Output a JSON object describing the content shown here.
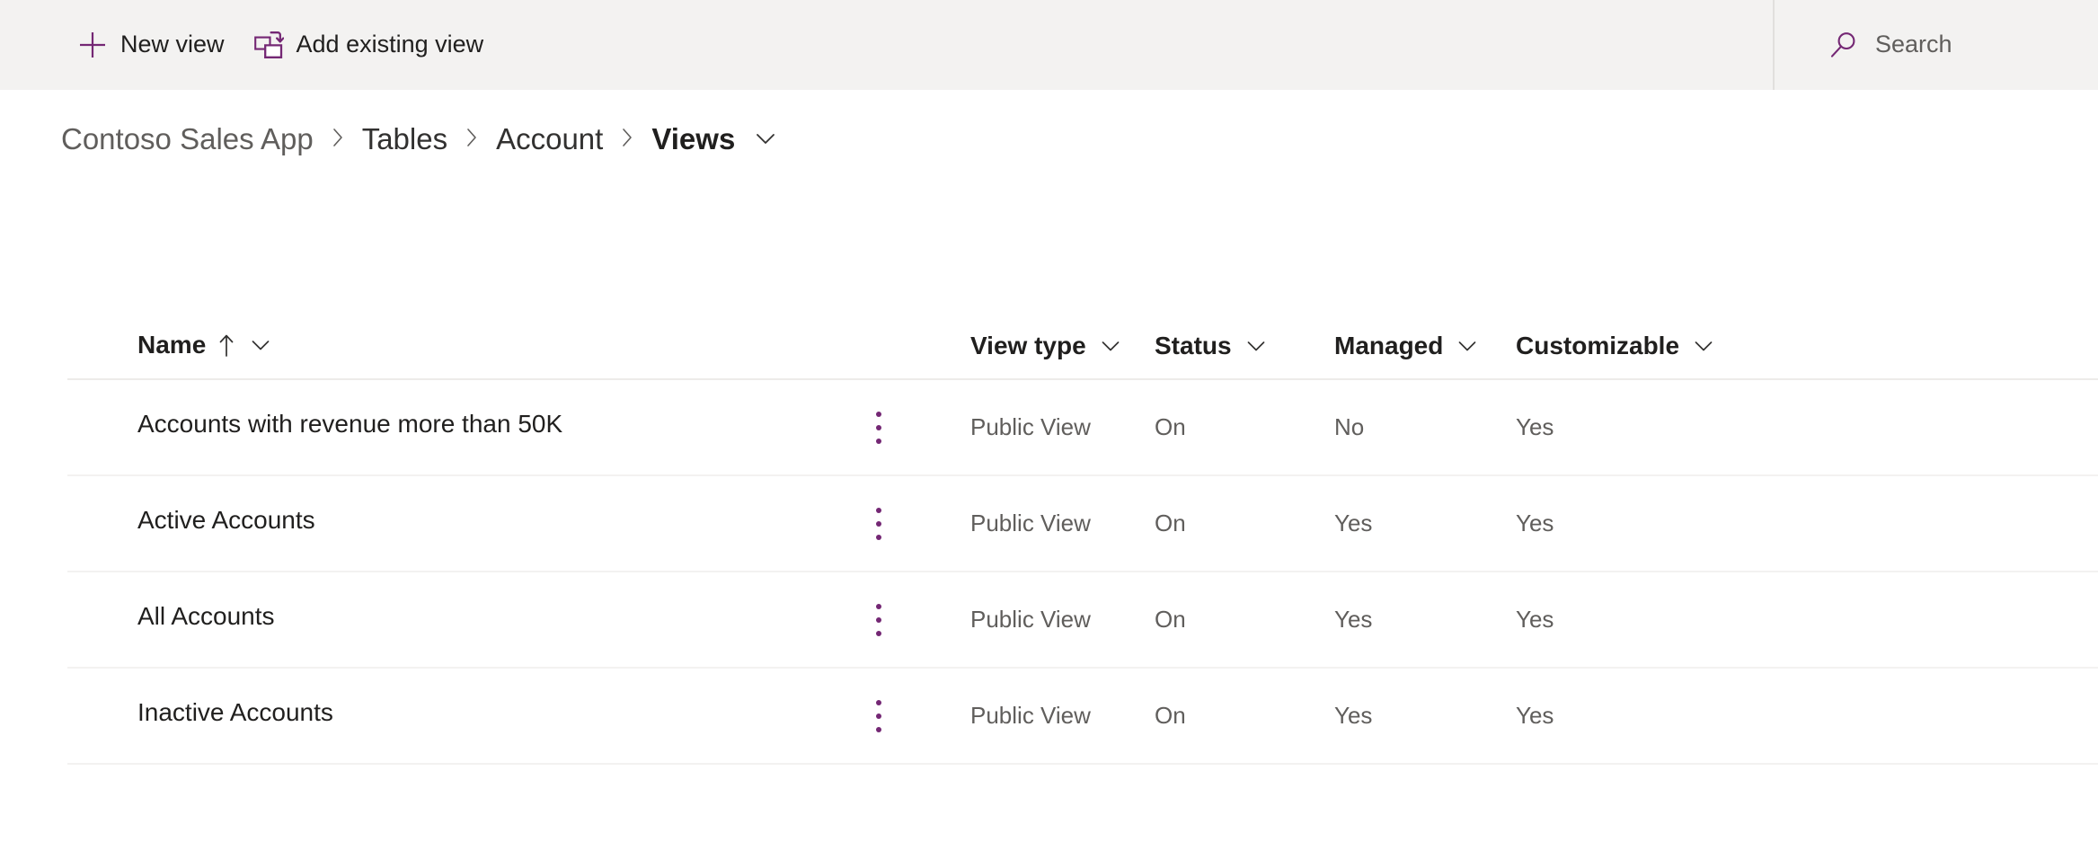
{
  "commandbar": {
    "new_view_label": "New view",
    "add_existing_label": "Add existing view",
    "search_label": "Search",
    "accent_color": "#742774",
    "background": "#f3f2f1"
  },
  "breadcrumb": {
    "items": [
      {
        "label": "Contoso Sales App",
        "current": false
      },
      {
        "label": "Tables",
        "current": false
      },
      {
        "label": "Account",
        "current": false
      },
      {
        "label": "Views",
        "current": true
      }
    ],
    "separator": "›"
  },
  "grid": {
    "columns": [
      {
        "key": "name",
        "label": "Name",
        "sorted": "asc"
      },
      {
        "key": "view_type",
        "label": "View type"
      },
      {
        "key": "status",
        "label": "Status"
      },
      {
        "key": "managed",
        "label": "Managed"
      },
      {
        "key": "customizable",
        "label": "Customizable"
      }
    ],
    "rows": [
      {
        "name": "Accounts with revenue more than 50K",
        "view_type": "Public View",
        "status": "On",
        "managed": "No",
        "customizable": "Yes"
      },
      {
        "name": "Active Accounts",
        "view_type": "Public View",
        "status": "On",
        "managed": "Yes",
        "customizable": "Yes"
      },
      {
        "name": "All Accounts",
        "view_type": "Public View",
        "status": "On",
        "managed": "Yes",
        "customizable": "Yes"
      },
      {
        "name": "Inactive Accounts",
        "view_type": "Public View",
        "status": "On",
        "managed": "Yes",
        "customizable": "Yes"
      }
    ]
  }
}
